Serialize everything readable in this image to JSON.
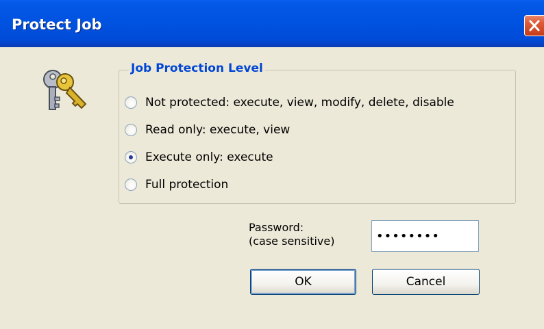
{
  "window": {
    "title": "Protect Job",
    "close_icon": "close-icon"
  },
  "group": {
    "legend": "Job Protection Level",
    "options": [
      {
        "label": "Not protected: execute, view, modify, delete, disable",
        "selected": false
      },
      {
        "label": "Read only: execute, view",
        "selected": false
      },
      {
        "label": "Execute only: execute",
        "selected": true
      },
      {
        "label": "Full protection",
        "selected": false
      }
    ]
  },
  "password": {
    "label_line1": "Password:",
    "label_line2": "(case sensitive)",
    "value": "••••••••"
  },
  "buttons": {
    "ok": "OK",
    "cancel": "Cancel"
  },
  "icons": {
    "dialog_icon": "keys-icon"
  },
  "colors": {
    "title_bar": "#0054E3",
    "legend_text": "#0046D5",
    "dialog_bg": "#ECE9D8"
  }
}
